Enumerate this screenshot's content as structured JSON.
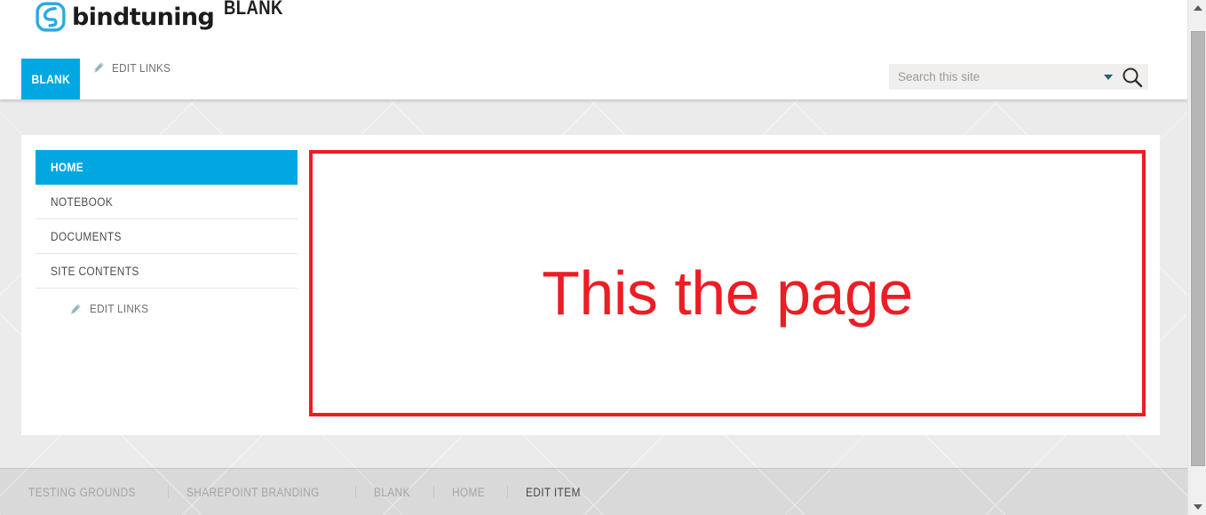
{
  "brand": {
    "logo_icon": "bindtuning-logo-icon",
    "name": "bindtuning",
    "accent_color": "#29abe2"
  },
  "header": {
    "site_title": "BLANK",
    "tab_label": "BLANK",
    "edit_links_label": "EDIT LINKS",
    "pencil_icon": "pencil-icon",
    "accent_color": "#00a7e1"
  },
  "search": {
    "placeholder": "Search this site",
    "value": "",
    "caret_icon": "chevron-down-icon",
    "caret_color": "#1c6673",
    "search_icon": "search-icon"
  },
  "sidebar": {
    "items": [
      {
        "label": "HOME",
        "active": true
      },
      {
        "label": "NOTEBOOK",
        "active": false
      },
      {
        "label": "DOCUMENTS",
        "active": false
      },
      {
        "label": "SITE CONTENTS",
        "active": false
      }
    ],
    "edit_links_label": "EDIT LINKS",
    "pencil_icon": "pencil-icon"
  },
  "content": {
    "webpart_text": "This the page",
    "border_color": "#ec1d24",
    "text_color": "#ec1d24"
  },
  "footer": {
    "breadcrumb": [
      {
        "label": "TESTING GROUNDS",
        "current": false
      },
      {
        "label": "SHAREPOINT BRANDING",
        "current": false
      },
      {
        "label": "BLANK",
        "current": false
      },
      {
        "label": "HOME",
        "current": false
      },
      {
        "label": "EDIT ITEM",
        "current": true
      }
    ]
  },
  "scrollbar": {
    "up_icon": "scroll-up-arrow-icon",
    "down_icon": "scroll-down-arrow-icon"
  }
}
